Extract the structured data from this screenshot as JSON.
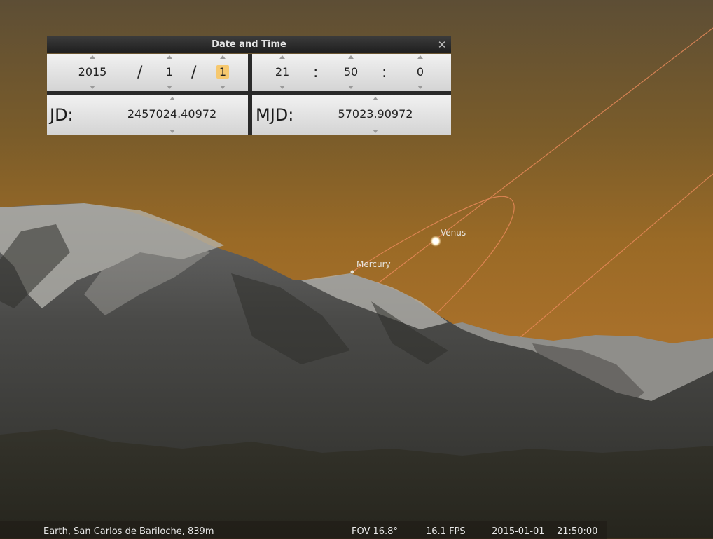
{
  "dialog": {
    "title": "Date and Time",
    "year": "2015",
    "month": "1",
    "day": "1",
    "hour": "21",
    "minute": "50",
    "second": "0",
    "date_separator": "/",
    "time_separator": ":",
    "jd_label": "JD:",
    "jd_value": "2457024.40972",
    "mjd_label": "MJD:",
    "mjd_value": "57023.90972"
  },
  "sky": {
    "objects": [
      {
        "name": "Venus"
      },
      {
        "name": "Mercury"
      }
    ]
  },
  "status": {
    "location": "Earth, San Carlos de Bariloche, 839m",
    "fov": "FOV 16.8°",
    "fps": "16.1 FPS",
    "date": "2015-01-01",
    "time": "21:50:00"
  },
  "colors": {
    "sky_top": "#5f4f33",
    "sky_horizon": "#a86e22",
    "orbit_line": "#e8895a",
    "highlight": "#f6c86e"
  }
}
